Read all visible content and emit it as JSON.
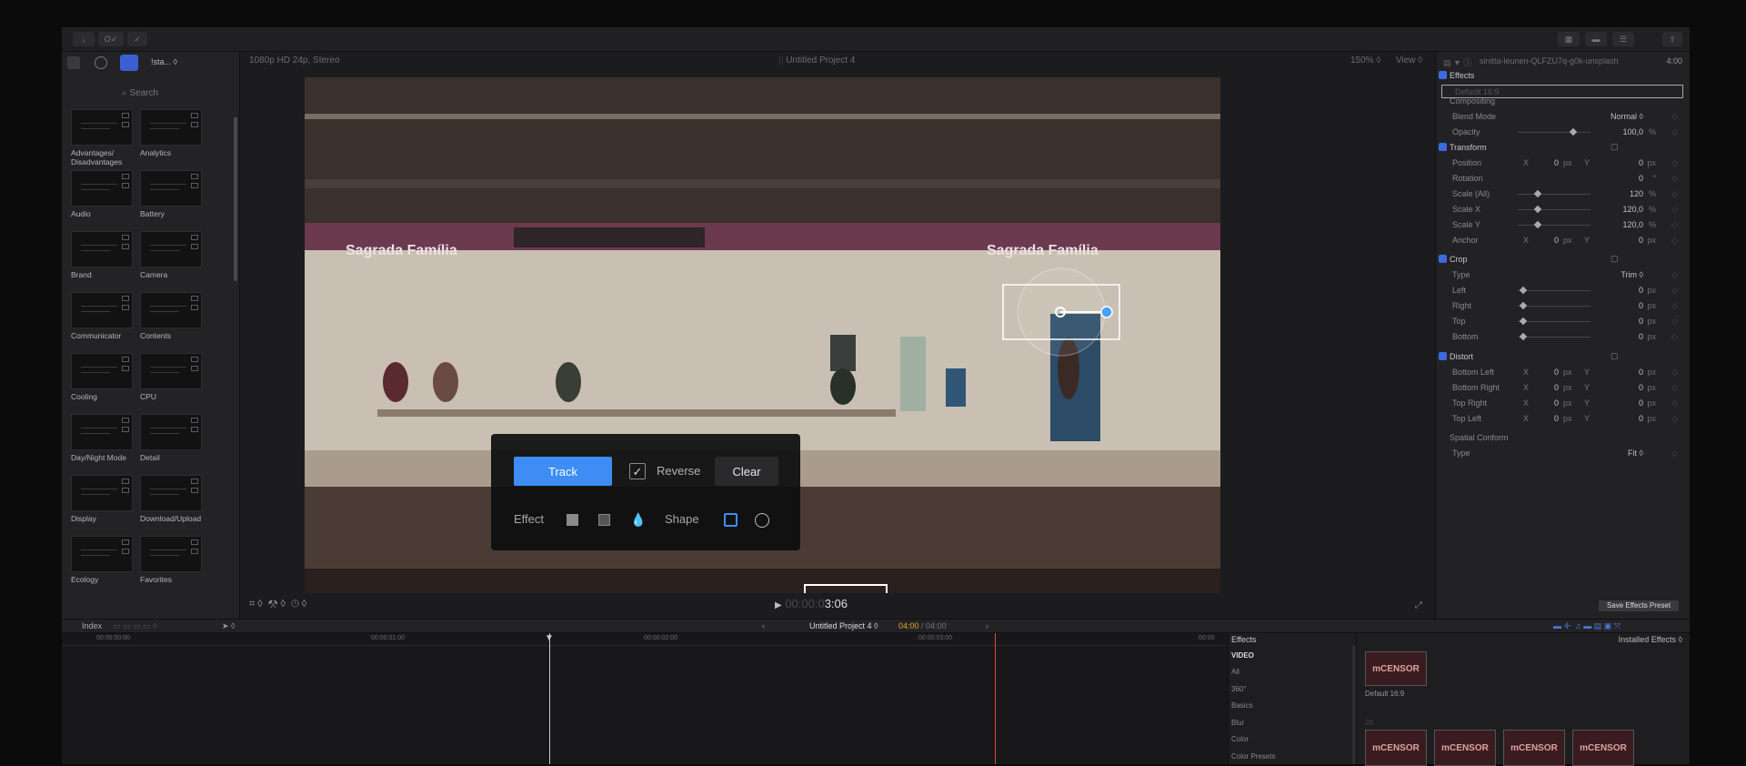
{
  "toolbar": {
    "left_buttons": [
      "↓",
      "O✓",
      "✓"
    ]
  },
  "browser": {
    "library_name": "!sta...",
    "search_placeholder": "Search",
    "tiles": [
      {
        "label": "Advantages/\nDisadvantages"
      },
      {
        "label": "Analytics"
      },
      {
        "label": "Audio"
      },
      {
        "label": "Battery"
      },
      {
        "label": "Brand"
      },
      {
        "label": "Camera"
      },
      {
        "label": "Communicator"
      },
      {
        "label": "Contents"
      },
      {
        "label": "Cooling"
      },
      {
        "label": "CPU"
      },
      {
        "label": "Day/Night Mode"
      },
      {
        "label": "Detail"
      },
      {
        "label": "Display"
      },
      {
        "label": "Download/Upload"
      },
      {
        "label": "Ecology"
      },
      {
        "label": "Favorites"
      }
    ]
  },
  "viewer": {
    "format": "1080p HD 24p, Stereo",
    "project_title": "Untitled Project 4",
    "zoom": "150%",
    "view_label": "View",
    "sign_left": "Sagrada Família",
    "sign_right": "Sagrada Família",
    "timecode_dim": "00:00:0",
    "timecode": "3:06"
  },
  "track_popup": {
    "track_label": "Track",
    "reverse_label": "Reverse",
    "reverse_checked": true,
    "clear_label": "Clear",
    "effect_label": "Effect",
    "shape_label": "Shape"
  },
  "inspector": {
    "clip_name": "sinitta-leunen-QLFZU7q-g0k-unsplash",
    "duration": "4:00",
    "effects_title": "Effects",
    "preset_field": "Default 16:9",
    "rows": [
      {
        "name": "Compositing",
        "type": "sub"
      },
      {
        "name": "Blend Mode",
        "value": "Normal ◊",
        "type": "row"
      },
      {
        "name": "Opacity",
        "value": "100,0",
        "unit": "%",
        "type": "slider",
        "knob_frac": 0.72
      },
      {
        "name": "Transform",
        "type": "hd"
      },
      {
        "name": "Position",
        "x": "0",
        "y": "0",
        "unit": "px",
        "type": "xy"
      },
      {
        "name": "Rotation",
        "value": "0",
        "unit": "°",
        "type": "row"
      },
      {
        "name": "Scale (All)",
        "value": "120",
        "unit": "%",
        "type": "slider",
        "knob_frac": 0.24
      },
      {
        "name": "Scale X",
        "value": "120,0",
        "unit": "%",
        "type": "slider",
        "knob_frac": 0.24
      },
      {
        "name": "Scale Y",
        "value": "120,0",
        "unit": "%",
        "type": "slider",
        "knob_frac": 0.24
      },
      {
        "name": "Anchor",
        "x": "0",
        "y": "0",
        "unit": "px",
        "type": "xy"
      },
      {
        "name": "Crop",
        "type": "hd"
      },
      {
        "name": "Type",
        "value": "Trim ◊",
        "type": "row"
      },
      {
        "name": "Left",
        "value": "0",
        "unit": "px",
        "type": "slider",
        "knob_frac": 0.04
      },
      {
        "name": "Right",
        "value": "0",
        "unit": "px",
        "type": "slider",
        "knob_frac": 0.04
      },
      {
        "name": "Top",
        "value": "0",
        "unit": "px",
        "type": "slider",
        "knob_frac": 0.04
      },
      {
        "name": "Bottom",
        "value": "0",
        "unit": "px",
        "type": "slider",
        "knob_frac": 0.04
      },
      {
        "name": "Distort",
        "type": "hd"
      },
      {
        "name": "Bottom Left",
        "x": "0",
        "y": "0",
        "unit": "px",
        "type": "xy"
      },
      {
        "name": "Bottom Right",
        "x": "0",
        "y": "0",
        "unit": "px",
        "type": "xy"
      },
      {
        "name": "Top Right",
        "x": "0",
        "y": "0",
        "unit": "px",
        "type": "xy"
      },
      {
        "name": "Top Left",
        "x": "0",
        "y": "0",
        "unit": "px",
        "type": "xy"
      },
      {
        "name": "Spatial Conform",
        "type": "sub"
      },
      {
        "name": "Type",
        "value": "Fit ◊",
        "type": "row"
      }
    ],
    "save_preset": "Save Effects Preset"
  },
  "timeline": {
    "index_label": "Index",
    "project": "Untitled Project 4",
    "position": "04:00",
    "total": "04:00",
    "ticks": [
      "00:00:00:00",
      "00:00:01:00",
      "00:00:02:00",
      "00:00:03:00",
      "00:00"
    ]
  },
  "effects_browser": {
    "title": "Effects",
    "installed": "Installed Effects",
    "section": "VIDEO",
    "categories": [
      "All",
      "360°",
      "Basics",
      "Blur",
      "Color",
      "Color Presets"
    ],
    "thumb_label": "Default 16:9",
    "thumb_text": "mCENSOR",
    "sub_section": "2K"
  },
  "colors": {
    "accent": "#3d8df5",
    "checkbox": "#3d6ae0",
    "timecode_orange": "#f0a030",
    "playhead_red": "#e04a3a"
  }
}
